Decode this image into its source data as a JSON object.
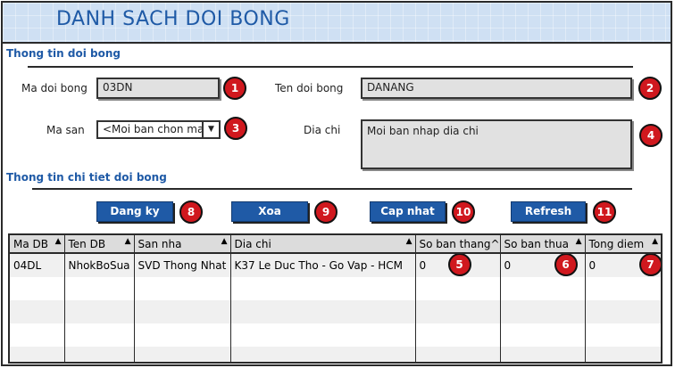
{
  "title": "DANH SACH DOI BONG",
  "section1": "Thong tin doi bong",
  "section2": "Thong tin chi tiet doi bong",
  "form": {
    "ma_doi_bong_label": "Ma doi bong",
    "ma_doi_bong_value": "03DN",
    "ten_doi_bong_label": "Ten doi bong",
    "ten_doi_bong_value": "DANANG",
    "ma_san_label": "Ma san",
    "ma_san_value": "<Moi ban chon ma",
    "dia_chi_label": "Dia chi",
    "dia_chi_value": "Moi ban nhap dia chi"
  },
  "buttons": {
    "dang_ky": "Dang ky",
    "xoa": "Xoa",
    "cap_nhat": "Cap nhat",
    "refresh": "Refresh"
  },
  "badges": [
    "1",
    "2",
    "3",
    "4",
    "5",
    "6",
    "7",
    "8",
    "9",
    "10",
    "11"
  ],
  "table": {
    "headers": [
      "Ma DB",
      "Ten DB",
      "San nha",
      "Dia chi",
      "So ban thang^",
      "So ban thua",
      "Tong diem"
    ],
    "rows": [
      [
        "04DL",
        "NhokBoSua",
        "SVD Thong Nhat",
        "K37 Le Duc Tho - Go Vap - HCM",
        "0",
        "0",
        "0"
      ]
    ]
  },
  "colors": {
    "accent": "#1f5aa6",
    "badge": "#d0181e",
    "title_bg": "#cfe0f3"
  }
}
